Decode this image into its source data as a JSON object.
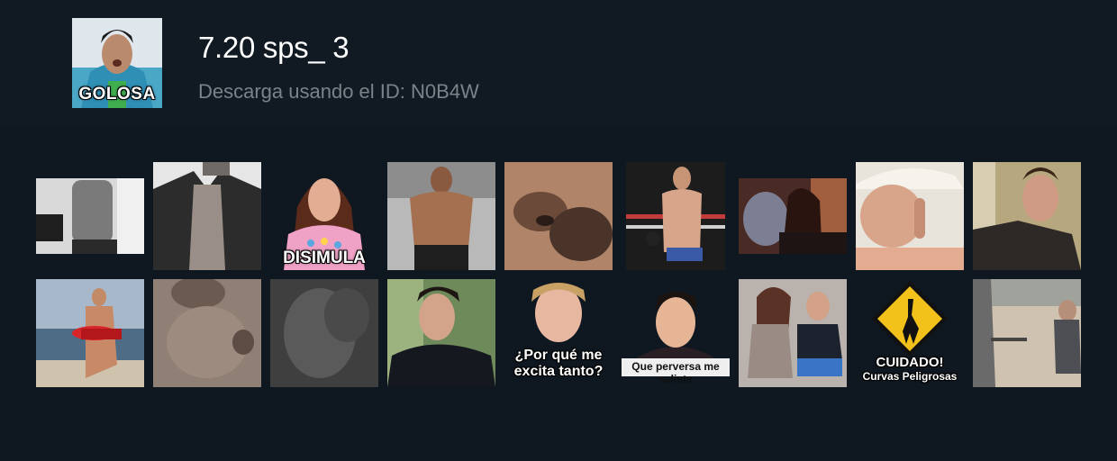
{
  "pack": {
    "title": "7.20 sps_ 3",
    "subtitle": "Descarga usando el ID: N0B4W",
    "icon_caption": "GOLOSA"
  },
  "stickers": [
    {
      "name": "sticker-man-gray-shirt",
      "caption": ""
    },
    {
      "name": "sticker-man-open-shirt",
      "caption": ""
    },
    {
      "name": "sticker-woman-disimula",
      "caption": "DISIMULA"
    },
    {
      "name": "sticker-shirtless-man",
      "caption": ""
    },
    {
      "name": "sticker-closeup-face",
      "caption": ""
    },
    {
      "name": "sticker-boxing-ring",
      "caption": ""
    },
    {
      "name": "sticker-couple-bed",
      "caption": ""
    },
    {
      "name": "sticker-cowboy-hat",
      "caption": ""
    },
    {
      "name": "sticker-man-pointing",
      "caption": ""
    },
    {
      "name": "sticker-lifeguard-beach",
      "caption": ""
    },
    {
      "name": "sticker-wet-skin",
      "caption": ""
    },
    {
      "name": "sticker-dark-blur",
      "caption": ""
    },
    {
      "name": "sticker-man-dark-hair",
      "caption": ""
    },
    {
      "name": "sticker-por-que-me-excita",
      "caption": "¿Por qué me excita tanto?"
    },
    {
      "name": "sticker-que-perversa",
      "caption": "Que perversa me saliste"
    },
    {
      "name": "sticker-couple-couch",
      "caption": ""
    },
    {
      "name": "sticker-cuidado-curvas",
      "caption": "CUIDADO!",
      "caption2": "Curvas Peligrosas"
    },
    {
      "name": "sticker-street-scene",
      "caption": ""
    }
  ]
}
